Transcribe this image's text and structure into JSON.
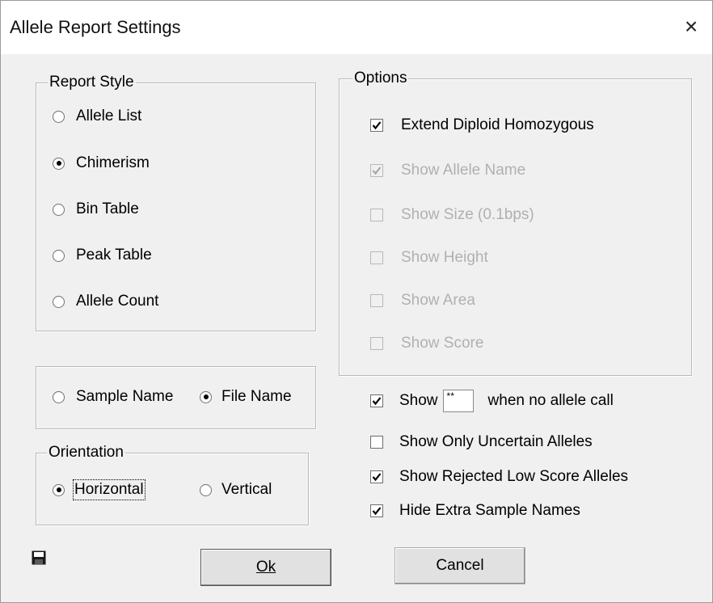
{
  "window": {
    "title": "Allele Report Settings",
    "close_glyph": "×"
  },
  "report_style": {
    "legend": "Report Style",
    "options": [
      {
        "label": "Allele List",
        "selected": false
      },
      {
        "label": "Chimerism",
        "selected": true
      },
      {
        "label": "Bin Table",
        "selected": false
      },
      {
        "label": "Peak Table",
        "selected": false
      },
      {
        "label": "Allele Count",
        "selected": false
      }
    ]
  },
  "name_source": {
    "options": [
      {
        "label": "Sample Name",
        "selected": false
      },
      {
        "label": "File Name",
        "selected": true
      }
    ]
  },
  "orientation": {
    "legend": "Orientation",
    "options": [
      {
        "label": "Horizontal",
        "selected": true
      },
      {
        "label": "Vertical",
        "selected": false
      }
    ]
  },
  "options_group": {
    "legend": "Options",
    "items": [
      {
        "label": "Extend Diploid Homozygous",
        "checked": true,
        "enabled": true
      },
      {
        "label": "Show Allele Name",
        "checked": true,
        "enabled": false
      },
      {
        "label": "Show Size (0.1bps)",
        "checked": false,
        "enabled": false
      },
      {
        "label": "Show Height",
        "checked": false,
        "enabled": false
      },
      {
        "label": "Show Area",
        "checked": false,
        "enabled": false
      },
      {
        "label": "Show Score",
        "checked": false,
        "enabled": false
      }
    ]
  },
  "extra_options": {
    "show_prefix": "Show",
    "no_call_value": "**",
    "show_suffix": "when no allele call",
    "show_checked": true,
    "items": [
      {
        "label": "Show Only Uncertain Alleles",
        "checked": false
      },
      {
        "label": "Show Rejected Low Score Alleles",
        "checked": true
      },
      {
        "label": "Hide Extra Sample Names",
        "checked": true
      }
    ]
  },
  "buttons": {
    "ok": "Ok",
    "cancel": "Cancel"
  },
  "icons": {
    "save": "save-icon",
    "check": "checkmark-icon"
  }
}
